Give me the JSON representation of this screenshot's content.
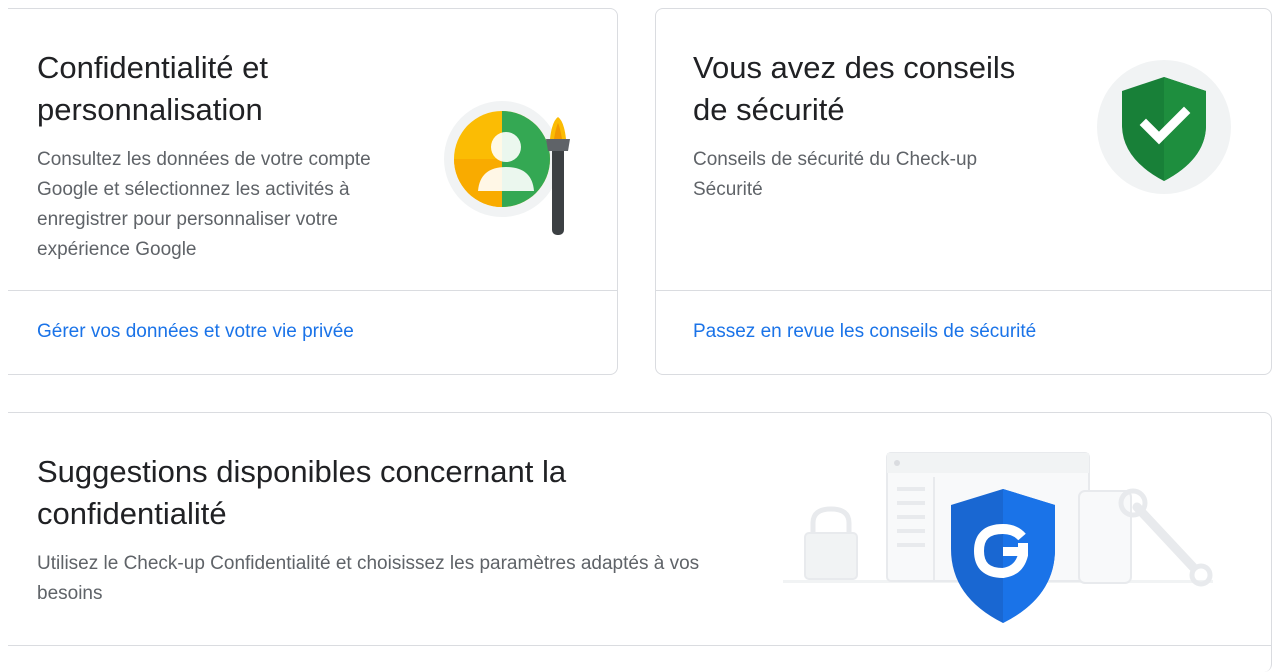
{
  "cards": {
    "privacy": {
      "title": "Confidentialité et personnalisation",
      "description": "Consultez les données de votre compte Google et sélectionnez les activités à enregistrer pour personnaliser votre expérience Google",
      "link": "Gérer vos données et votre vie privée",
      "illustration_icon": "privacy-personalization-icon"
    },
    "security": {
      "title": "Vous avez des conseils de sécurité",
      "description": "Conseils de sécurité du Check-up Sécurité",
      "link": "Passez en revue les conseils de sécurité",
      "illustration_icon": "security-shield-check-icon"
    },
    "suggestions": {
      "title": "Suggestions disponibles concernant la confidentialité",
      "description": "Utilisez le Check-up Confidentialité et choisissez les paramètres adaptés à vos besoins",
      "illustration_icon": "google-shield-icon"
    }
  },
  "colors": {
    "link_blue": "#1a73e8",
    "shield_green": "#1e8e3e",
    "shield_blue": "#1a73e8",
    "google_yellow": "#fbbc04",
    "google_green": "#34a853"
  }
}
